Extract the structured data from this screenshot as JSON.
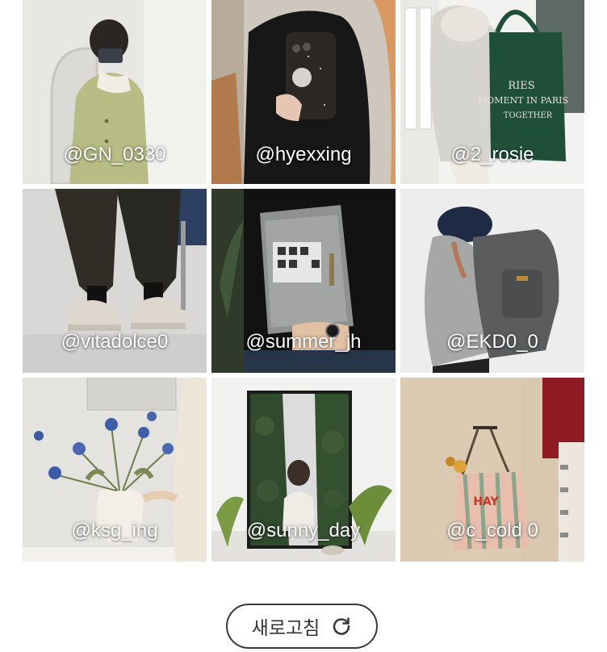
{
  "gallery": {
    "items": [
      {
        "handle": "@GN_0330"
      },
      {
        "handle": "@hyexxing"
      },
      {
        "handle": "@2_rosie"
      },
      {
        "handle": "@vitadolce0"
      },
      {
        "handle": "@summer_jh"
      },
      {
        "handle": "@EKD0_0"
      },
      {
        "handle": "@ksg_ing"
      },
      {
        "handle": "@sunny_day"
      },
      {
        "handle": "@c_cold 0"
      }
    ]
  },
  "refresh_button": {
    "label": "새로고침",
    "icon": "refresh-icon"
  }
}
